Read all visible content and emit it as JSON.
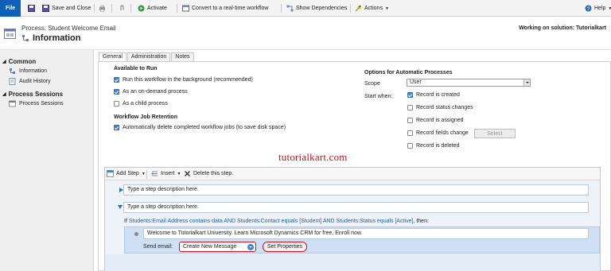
{
  "toolbar": {
    "file": "File",
    "save_close": "Save and Close",
    "activate": "Activate",
    "convert": "Convert to a real-time workflow",
    "show_dependencies": "Show Dependencies",
    "actions": "Actions",
    "help": "Help"
  },
  "header": {
    "process_line": "Process: Student Welcome Email",
    "title": "Information",
    "solution": "Working on solution: Tutorialkart"
  },
  "nav": {
    "common": "Common",
    "information": "Information",
    "audit_history": "Audit History",
    "process_sessions_head": "Process Sessions",
    "process_sessions": "Process Sessions"
  },
  "tabs": [
    "General",
    "Administration",
    "Notes"
  ],
  "available": {
    "heading": "Available to Run",
    "bg": "Run this workflow in the background (recommended)",
    "on_demand": "As an on-demand process",
    "child": "As a child process"
  },
  "retention": {
    "heading": "Workflow Job Retention",
    "auto_delete": "Automatically delete completed workflow jobs (to save disk space)"
  },
  "auto": {
    "heading": "Options for Automatic Processes",
    "scope_label": "Scope",
    "scope_value": "User",
    "start_label": "Start when:",
    "created": "Record is created",
    "status": "Record status changes",
    "assigned": "Record is assigned",
    "fields": "Record fields change",
    "select": "Select",
    "deleted": "Record is deleted"
  },
  "watermark": "tutorialkart.com",
  "editor": {
    "add_step": "Add Step",
    "insert": "Insert",
    "delete": "Delete this step.",
    "step1": "Type a step description here.",
    "step2": "Type a step description here.",
    "cond_if": "If ",
    "cond_link": "Students:Email Address contains data AND Students:Contact equals [Student] AND Students:Status equals [Active]",
    "cond_then": ", then:",
    "message": "Welcome to Tutorialkart University. Learn Microsoft Dynamics CRM for free, Enroll now.",
    "send_label": "Send email:",
    "send_value": "Create New Message",
    "set_properties": "Set Properties"
  },
  "colors": {
    "accent": "#1160b7",
    "highlight": "#d0111b",
    "link": "#1f5fa8"
  }
}
